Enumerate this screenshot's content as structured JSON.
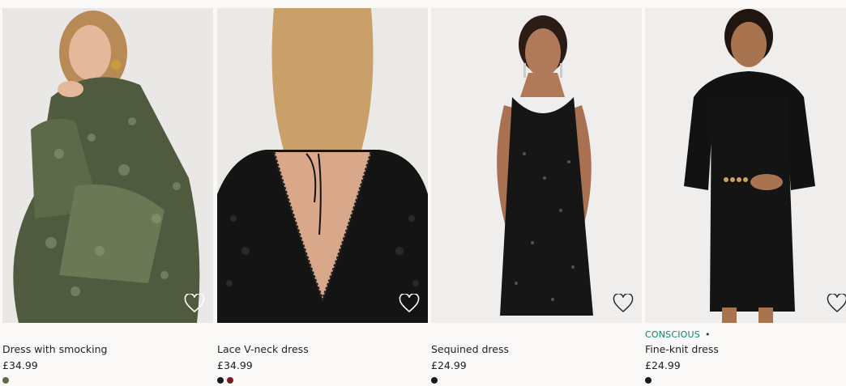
{
  "products": [
    {
      "title": "Dress with smocking",
      "price": "£34.99",
      "badge": "",
      "swatches": [
        "#5a6a4a"
      ],
      "icon": "heart-outline-icon"
    },
    {
      "title": "Lace V-neck dress",
      "price": "£34.99",
      "badge": "",
      "swatches": [
        "#1a1a1a",
        "#7a1c26"
      ],
      "icon": "heart-outline-icon"
    },
    {
      "title": "Sequined dress",
      "price": "£24.99",
      "badge": "",
      "swatches": [
        "#1a1a1a"
      ],
      "icon": "heart-outline-icon"
    },
    {
      "title": "Fine-knit dress",
      "price": "£24.99",
      "badge": "CONSCIOUS",
      "badge_separator": "•",
      "swatches": [
        "#1a1a1a"
      ],
      "icon": "heart-outline-icon"
    }
  ],
  "colors": {
    "background": "#faf9f8",
    "image_bg": "#ecebe9",
    "conscious_green": "#0a8a5e",
    "text": "#222222"
  }
}
